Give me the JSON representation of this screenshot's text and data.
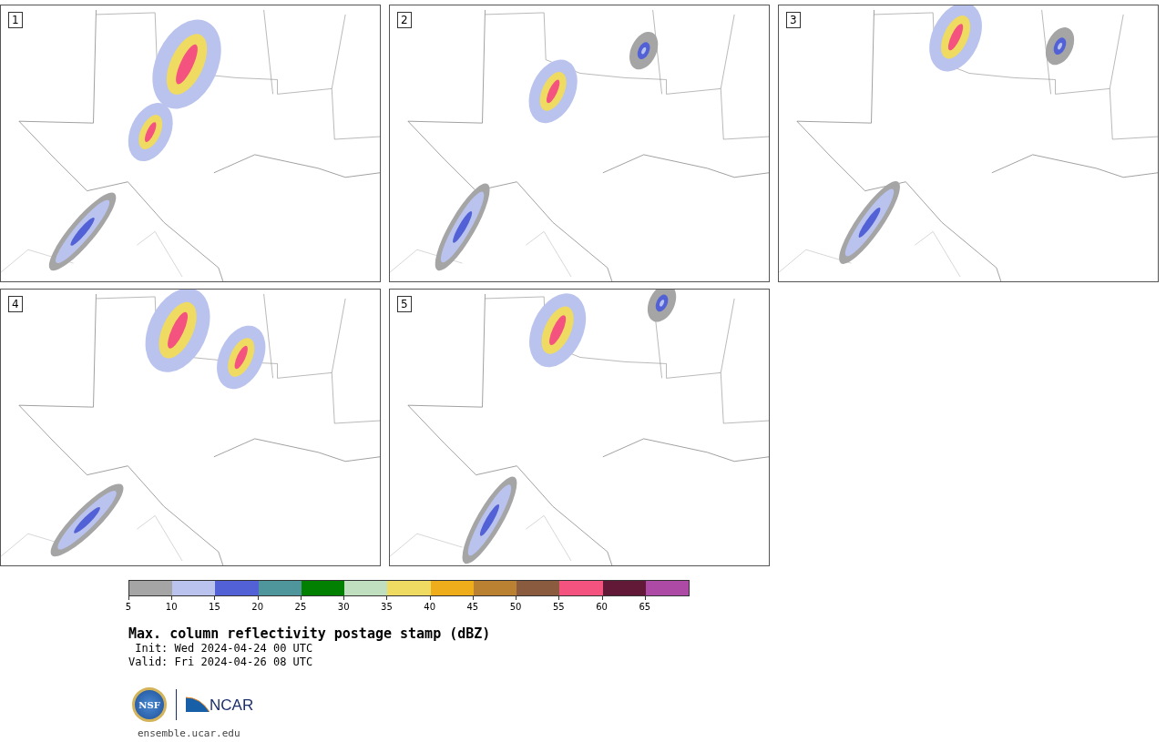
{
  "panels": [
    {
      "label": "1",
      "kind": "map-picture"
    },
    {
      "label": "2",
      "kind": "map-picture"
    },
    {
      "label": "3",
      "kind": "map-picture"
    },
    {
      "label": "4",
      "kind": "map-picture"
    },
    {
      "label": "5",
      "kind": "map-picture"
    }
  ],
  "colorbar": {
    "segments": [
      {
        "color": "#a5a5a5"
      },
      {
        "color": "#b9c3ee"
      },
      {
        "color": "#5262d6"
      },
      {
        "color": "#4f969c"
      },
      {
        "color": "#028001"
      },
      {
        "color": "#bfdfbf"
      },
      {
        "color": "#efdb61"
      },
      {
        "color": "#f0ad1b"
      },
      {
        "color": "#b98131"
      },
      {
        "color": "#8b5b40"
      },
      {
        "color": "#f4537f"
      },
      {
        "color": "#621837"
      },
      {
        "color": "#ad4aa5"
      }
    ],
    "ticks": [
      "5",
      "10",
      "15",
      "20",
      "25",
      "30",
      "35",
      "40",
      "45",
      "50",
      "55",
      "60",
      "65"
    ]
  },
  "title": "Max. column reflectivity postage stamp (dBZ)",
  "init": " Init: Wed 2024-04-24 00 UTC",
  "valid": "Valid: Fri 2024-04-26 08 UTC",
  "logos": {
    "nsf": "NSF",
    "ncar": "NCAR"
  },
  "website": "ensemble.ucar.edu"
}
